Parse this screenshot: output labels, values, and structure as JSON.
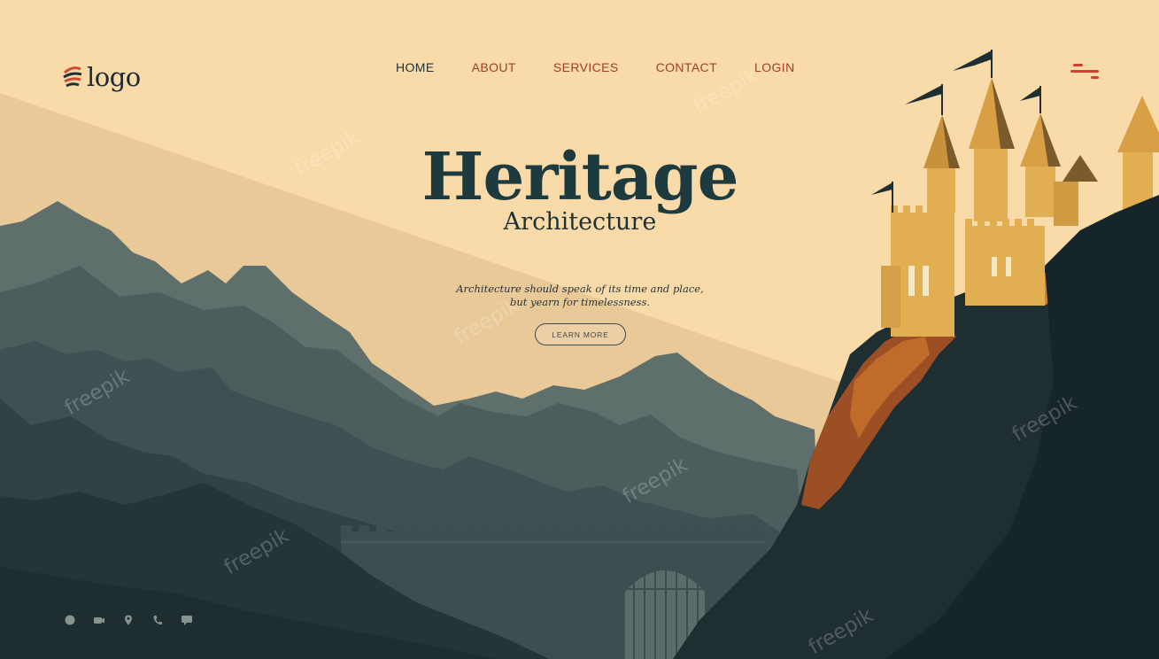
{
  "brand": {
    "logo_text": "logo",
    "accent": "#d83d32",
    "primary": "#1f2f37"
  },
  "nav": {
    "items": [
      "HOME",
      "ABOUT",
      "SERVICES",
      "CONTACT",
      "LOGIN"
    ]
  },
  "hero": {
    "title": "Heritage",
    "subtitle": "Architecture",
    "quote_line1": "Architecture should speak of its time and place,",
    "quote_line2": "but yearn for timelessness.",
    "cta_label": "LEARN MORE"
  },
  "socials": [
    "globe-icon",
    "video-icon",
    "location-pin-icon",
    "phone-icon",
    "chat-icon"
  ],
  "watermark": "freepik"
}
